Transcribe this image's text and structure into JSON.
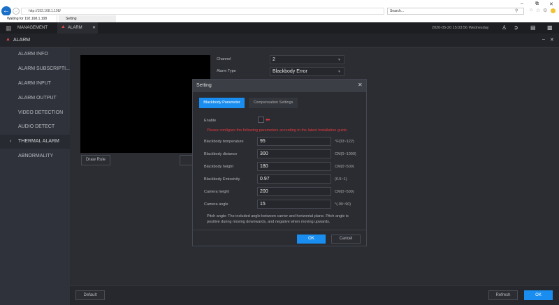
{
  "browser": {
    "url": "http://192.168.1.108/",
    "search_placeholder": "Search...",
    "tabs": [
      "Waiting for 192.168.1.108",
      "Setting"
    ]
  },
  "app": {
    "tabs": [
      "MANAGEMENT",
      "ALARM"
    ],
    "datetime": "2020-05-20 15:03:56 Wednesday",
    "section_title": "ALARM"
  },
  "sidebar": {
    "items": [
      {
        "label": "ALARM INFO"
      },
      {
        "label": "ALARM SUBSCRIPTI..."
      },
      {
        "label": "ALARM INPUT"
      },
      {
        "label": "ALARM OUTPUT"
      },
      {
        "label": "VIDEO DETECTION"
      },
      {
        "label": "AUDIO DETECT"
      },
      {
        "label": "THERMAL ALARM",
        "active": true
      },
      {
        "label": "ABNORMALITY"
      }
    ]
  },
  "main": {
    "draw_rule": "Draw Rule",
    "channel_label": "Channel",
    "channel_value": "2",
    "alarm_type_label": "Alarm Type",
    "alarm_type_value": "Blackbody Error"
  },
  "dialog": {
    "title": "Setting",
    "tabs": [
      "Blackbody Parameter",
      "Compensation Settings"
    ],
    "enable_label": "Enable",
    "enabled": false,
    "warning": "Please configure the following parameters according to the latest installation guide.",
    "fields": [
      {
        "label": "Blackbody temperature",
        "value": "95",
        "range": "°F(33~122)"
      },
      {
        "label": "Blackbody distance",
        "value": "300",
        "range": "CM(0~1000)"
      },
      {
        "label": "Blackbody height",
        "value": "180",
        "range": "CM(0~500)"
      },
      {
        "label": "Blackbody Emissivity",
        "value": "0.97",
        "range": "(0.5~1)"
      },
      {
        "label": "Camera height",
        "value": "200",
        "range": "CM(0~500)"
      },
      {
        "label": "Camera angle",
        "value": "15",
        "range": "°(-90~90)"
      }
    ],
    "note": "Pitch angle: The included angle between carrier and horizontal plane. Pitch angle is positive during moving downwards, and negative when moving upwards.",
    "ok": "OK",
    "cancel": "Cancel"
  },
  "footer": {
    "default": "Default",
    "refresh": "Refresh",
    "ok": "OK"
  },
  "colors": {
    "accent": "#1a8ef0",
    "warning": "#e0393e",
    "alarm": "#e04848"
  }
}
